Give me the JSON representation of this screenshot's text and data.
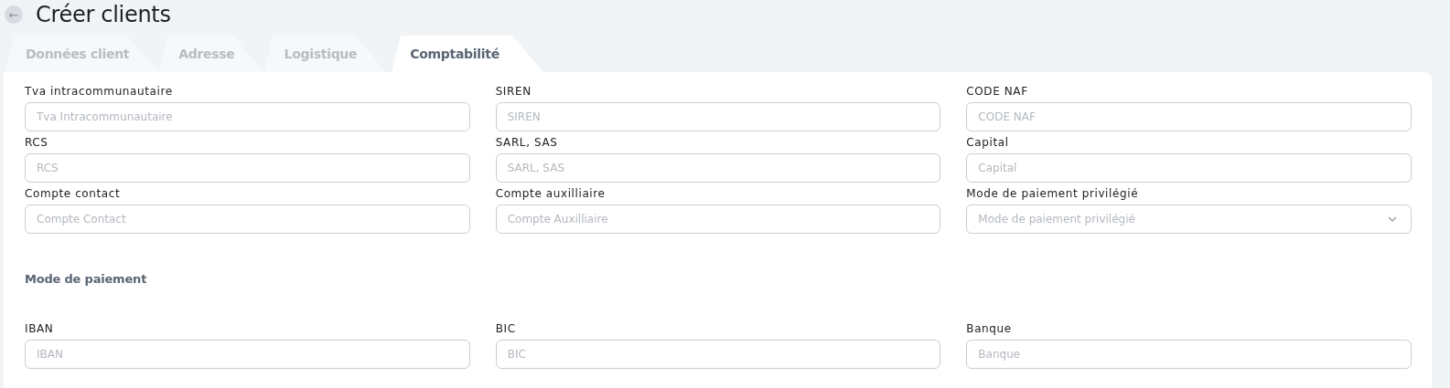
{
  "header": {
    "back_button": "←",
    "title": "Créer clients"
  },
  "tabs": [
    {
      "label": "Données client",
      "selected": false
    },
    {
      "label": "Adresse",
      "selected": false
    },
    {
      "label": "Logistique",
      "selected": false
    },
    {
      "label": "Comptabilité",
      "selected": true
    }
  ],
  "fields": [
    {
      "label": "Tva intracommunautaire",
      "placeholder": "Tva Intracommunautaire",
      "kind": "text"
    },
    {
      "label": "SIREN",
      "placeholder": "SIREN",
      "kind": "text"
    },
    {
      "label": "CODE NAF",
      "placeholder": "CODE NAF",
      "kind": "text"
    },
    {
      "label": "RCS",
      "placeholder": "RCS",
      "kind": "text"
    },
    {
      "label": "SARL, SAS",
      "placeholder": "SARL, SAS",
      "kind": "text"
    },
    {
      "label": "Capital",
      "placeholder": "Capital",
      "kind": "text"
    },
    {
      "label": "Compte contact",
      "placeholder": "Compte Contact",
      "kind": "text"
    },
    {
      "label": "Compte auxilliaire",
      "placeholder": "Compte Auxilliaire",
      "kind": "text"
    },
    {
      "label": "Mode de paiement privilégié",
      "placeholder": "Mode de paiement privilégié",
      "kind": "select"
    }
  ],
  "payment_section": {
    "title": "Mode de paiement",
    "fields": [
      {
        "label": "IBAN",
        "placeholder": "IBAN",
        "kind": "text"
      },
      {
        "label": "BIC",
        "placeholder": "BIC",
        "kind": "text"
      },
      {
        "label": "Banque",
        "placeholder": "Banque",
        "kind": "text"
      }
    ]
  }
}
